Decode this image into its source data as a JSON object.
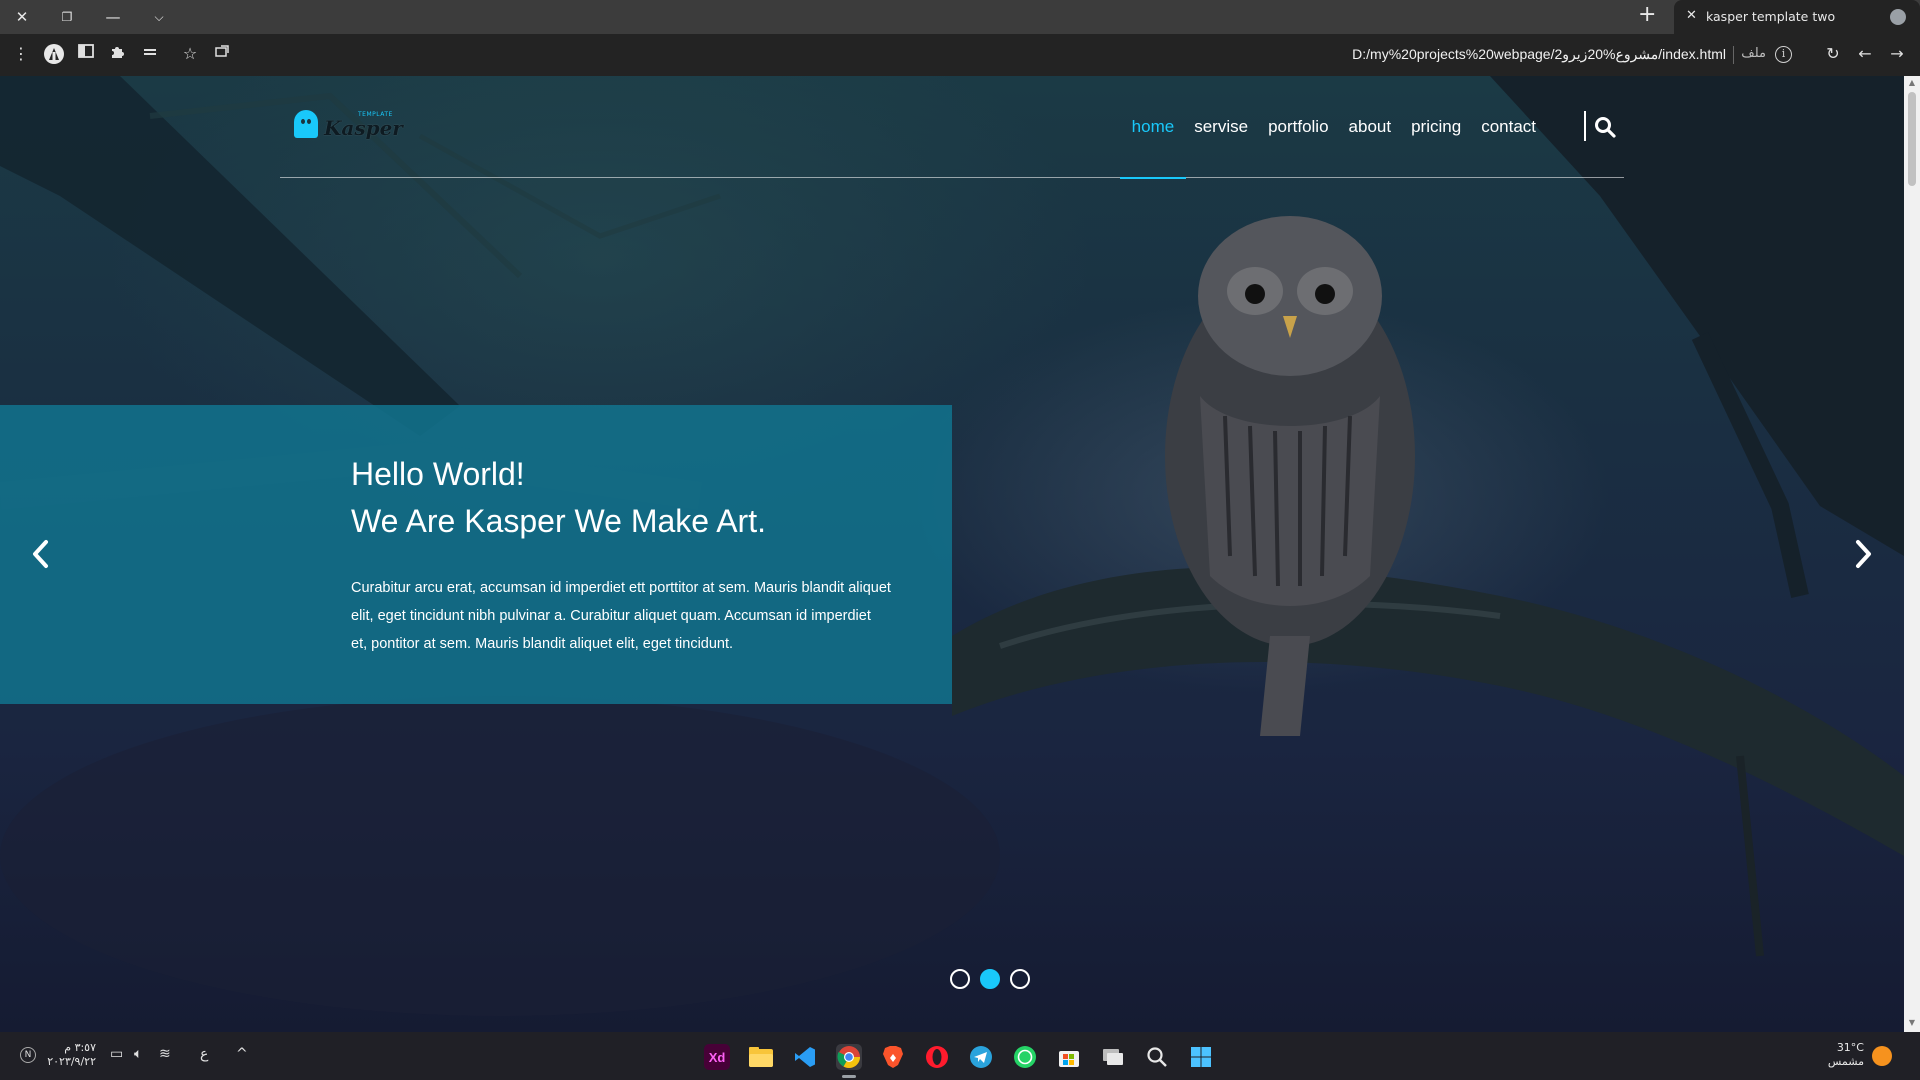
{
  "browser": {
    "tab_title": "kasper template two",
    "tab_close": "✕",
    "new_tab": "+",
    "url": "D:/my%20projects%20webpage/2مشروع%20زيرو/index.html",
    "url_label": "ملف",
    "info": "i"
  },
  "header": {
    "logo_small": "TEMPLATE",
    "logo_text": "Kasper",
    "nav": [
      "home",
      "servise",
      "portfolio",
      "about",
      "pricing",
      "contact"
    ],
    "active_nav": "home"
  },
  "hero": {
    "title_line1": "Hello World!",
    "title_line2": "We Are Kasper We Make Art.",
    "body": "Curabitur arcu erat, accumsan id imperdiet ett porttitor at sem. Mauris blandit aliquet elit, eget tincidunt nibh pulvinar a. Curabitur aliquet quam. Accumsan id imperdiet et, pontitor at sem. Mauris blandit aliquet elit, eget tincidunt.",
    "slides": 3,
    "active_slide": 2
  },
  "taskbar": {
    "time": "٣:٥٧ م",
    "date": "٢٠٢٣/٩/٢٢",
    "lang": "ع",
    "weather_temp": "31°C",
    "weather_desc": "مشمس",
    "xd_label": "Xd"
  },
  "colors": {
    "accent": "#19c8fa",
    "panel": "#117691",
    "tab_bar": "#3c3c3c",
    "toolbar": "#232323",
    "taskbar": "#202026"
  }
}
